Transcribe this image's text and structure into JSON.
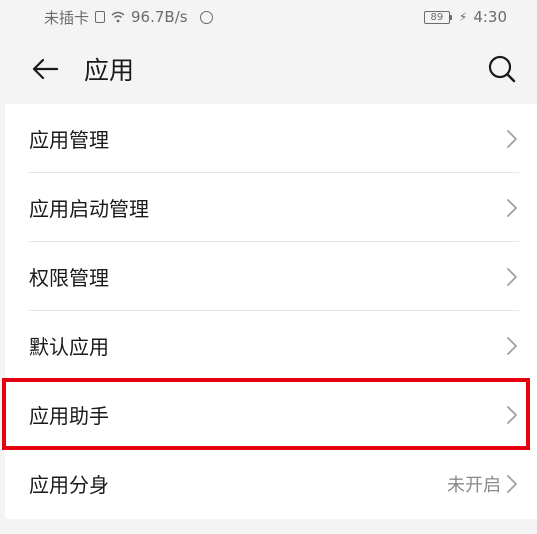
{
  "status_bar": {
    "carrier": "未插卡",
    "network_speed": "96.7B/s",
    "battery": "89",
    "time": "4:30"
  },
  "header": {
    "title": "应用"
  },
  "menu": {
    "items": [
      {
        "label": "应用管理"
      },
      {
        "label": "应用启动管理"
      },
      {
        "label": "权限管理"
      },
      {
        "label": "默认应用"
      },
      {
        "label": "应用助手"
      },
      {
        "label": "应用分身",
        "value": "未开启"
      }
    ]
  },
  "colors": {
    "highlight": "#e60012",
    "background": "#f4f4f4"
  }
}
